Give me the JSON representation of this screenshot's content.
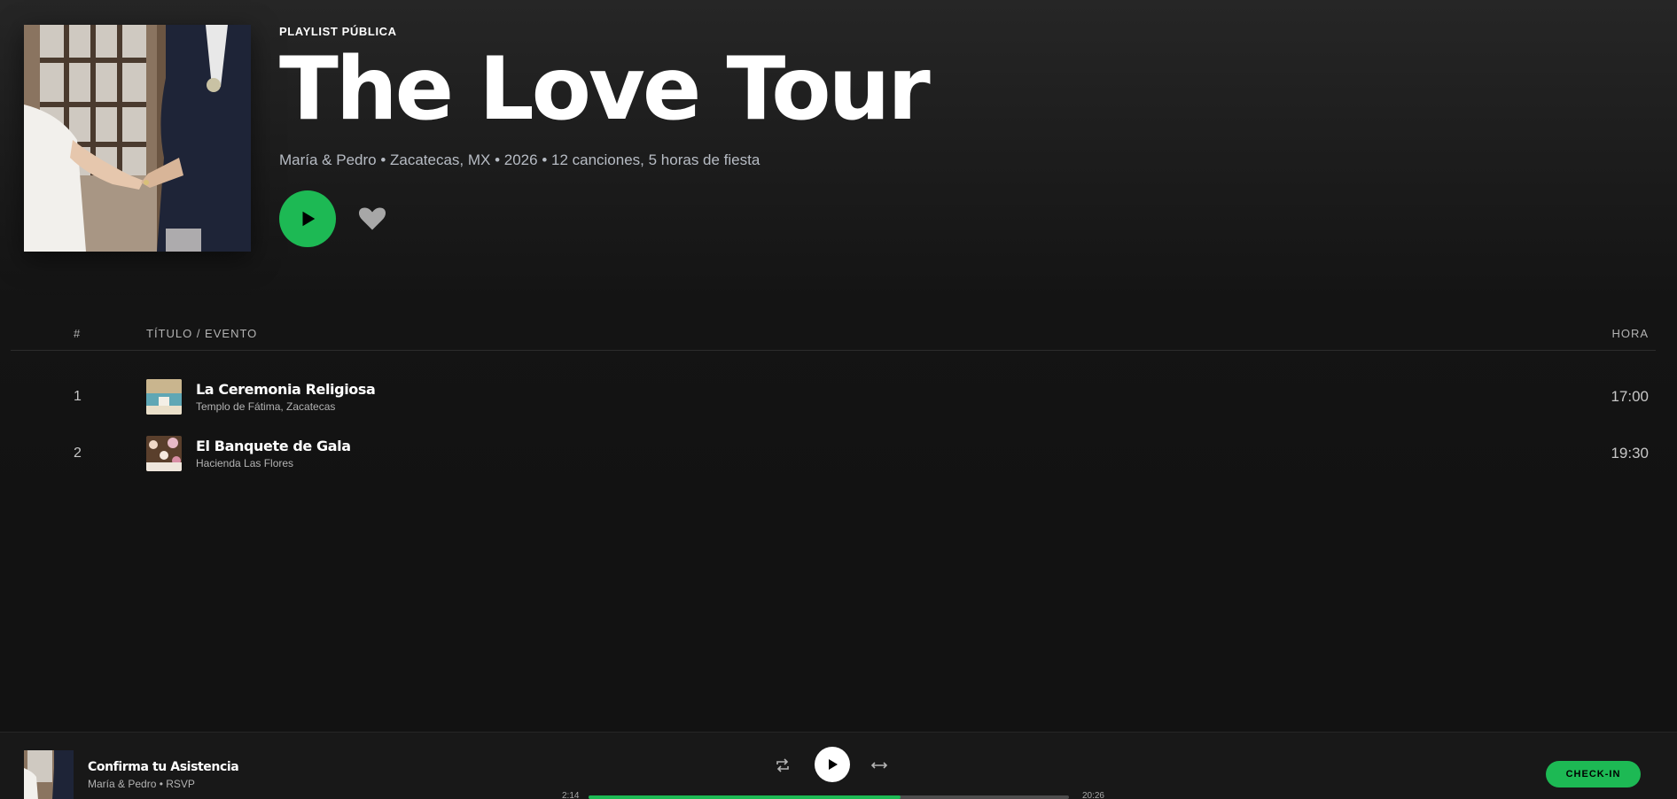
{
  "playlist": {
    "eyebrow": "PLAYLIST PÚBLICA",
    "title": "The Love Tour",
    "meta": "María & Pedro • Zacatecas, MX • 2026 • 12 canciones, 5 horas de fiesta"
  },
  "table": {
    "col_num": "#",
    "col_title": "TÍTULO / EVENTO",
    "col_time": "HORA",
    "rows": [
      {
        "num": "1",
        "title": "La Ceremonia Religiosa",
        "subtitle": "Templo de Fátima, Zacatecas",
        "time": "17:00"
      },
      {
        "num": "2",
        "title": "El Banquete de Gala",
        "subtitle": "Hacienda Las Flores",
        "time": "19:30"
      }
    ]
  },
  "player": {
    "title": "Confirma tu Asistencia",
    "subtitle": "María & Pedro • RSVP",
    "current_time": "2:14",
    "total_time": "20:26",
    "progress_fraction": 0.65,
    "checkin_label": "CHECK-IN"
  },
  "colors": {
    "accent": "#1db954",
    "background": "#121212"
  },
  "icons": {
    "play": "play-icon",
    "like": "heart-icon",
    "repeat": "repeat-icon",
    "swap": "swap-icon"
  }
}
